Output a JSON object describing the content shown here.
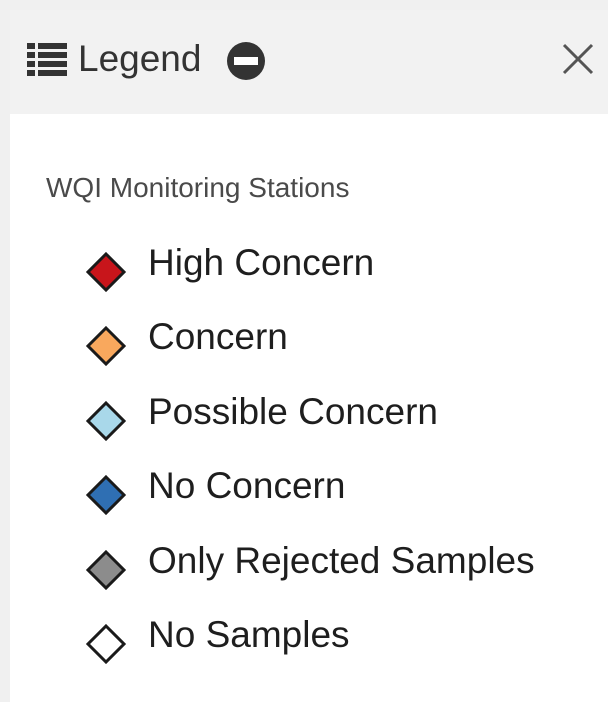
{
  "header": {
    "title": "Legend",
    "list_icon": "list-icon",
    "collapse_icon": "minus-circle-icon",
    "close_icon": "close-icon"
  },
  "layer": {
    "title": "WQI Monitoring Stations"
  },
  "legend": {
    "items": [
      {
        "label": "High Concern",
        "color": "#c8151b"
      },
      {
        "label": "Concern",
        "color": "#f9a85d"
      },
      {
        "label": "Possible Concern",
        "color": "#a9d8ea"
      },
      {
        "label": "No Concern",
        "color": "#2f6fb3"
      },
      {
        "label": "Only Rejected Samples",
        "color": "#8c8c8c"
      },
      {
        "label": "No Samples",
        "color": "#ffffff"
      }
    ]
  }
}
